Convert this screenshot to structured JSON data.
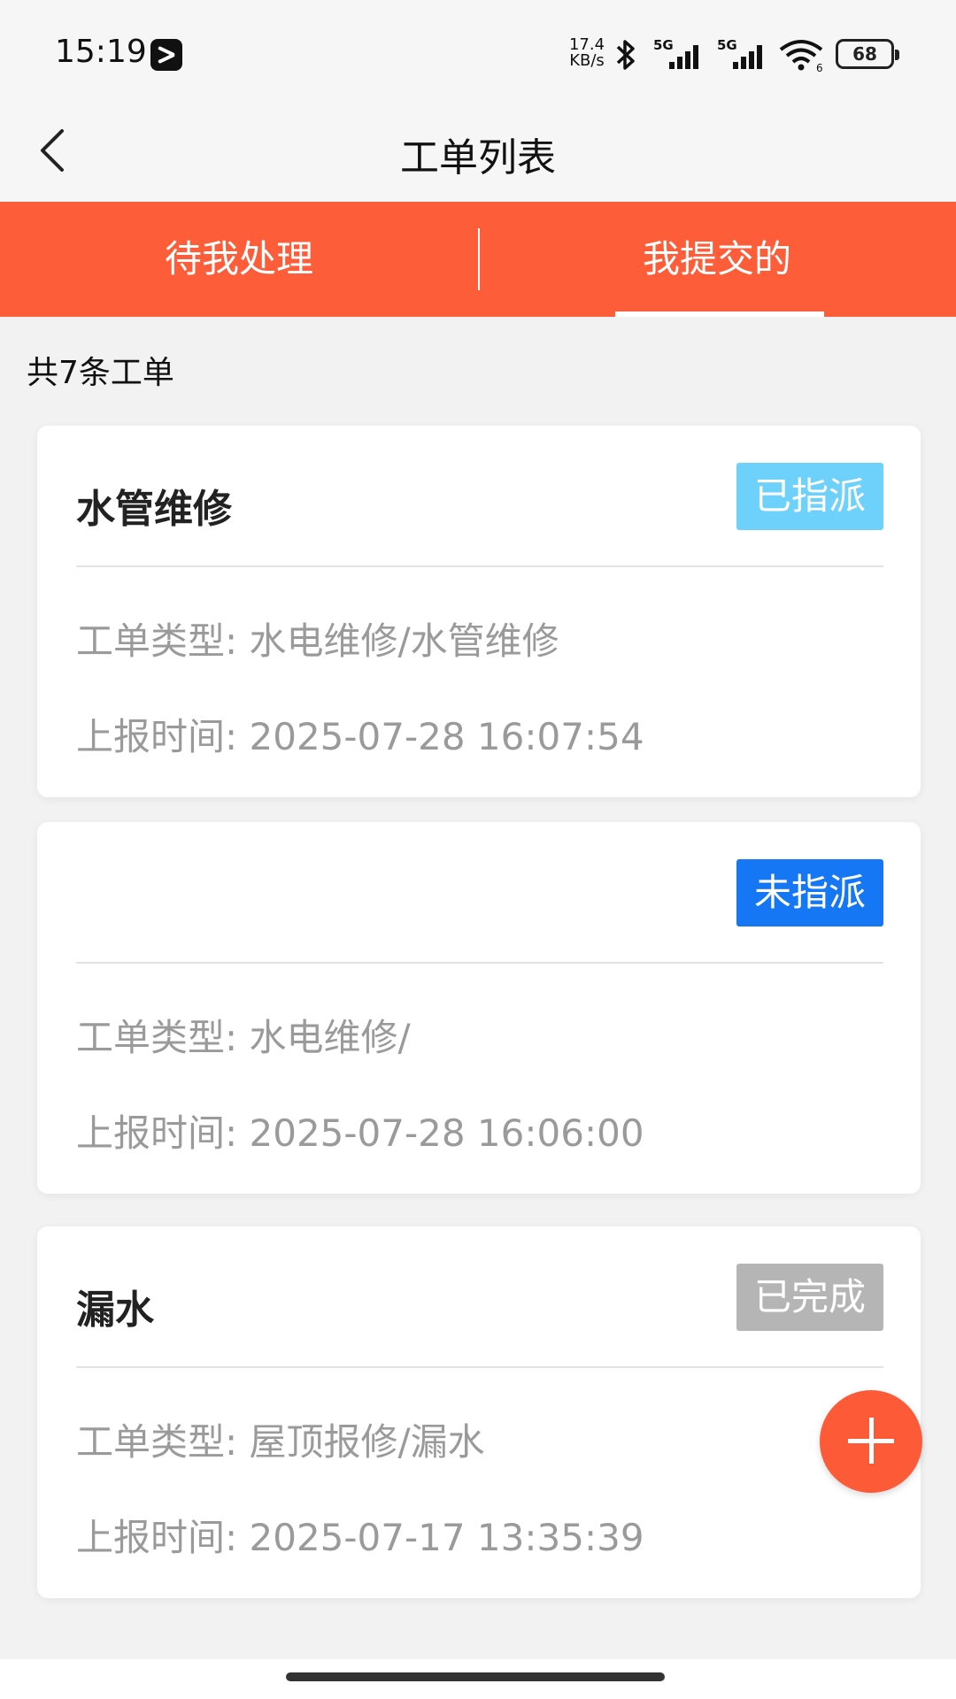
{
  "status_bar": {
    "time": "15:19",
    "net_speed_value": "17.4",
    "net_speed_unit": "KB/s",
    "signal_1_label": "5G",
    "signal_2_label": "5G",
    "wifi_level": "6",
    "battery": "68"
  },
  "header": {
    "title": "工单列表"
  },
  "tabs": [
    {
      "label": "待我处理",
      "active": false
    },
    {
      "label": "我提交的",
      "active": true
    }
  ],
  "count_text": "共7条工单",
  "cards": [
    {
      "title": "水管维修",
      "status": "已指派",
      "status_color": "#6dd1fb",
      "type_line": "工单类型: 水电维修/水管维修",
      "time_line": "上报时间: 2025-07-28 16:07:54"
    },
    {
      "title": "",
      "status": "未指派",
      "status_color": "#1677f5",
      "type_line": "工单类型: 水电维修/",
      "time_line": "上报时间: 2025-07-28 16:06:00"
    },
    {
      "title": "漏水",
      "status": "已完成",
      "status_color": "#b5b5b5",
      "type_line": "工单类型: 屋顶报修/漏水",
      "time_line": "上报时间: 2025-07-17 13:35:39"
    }
  ],
  "colors": {
    "accent": "#fd5d38",
    "fab": "#fd5a37",
    "background": "#f2f2f2"
  },
  "icons": [
    "capcut-icon",
    "bluetooth-icon",
    "signal-icon",
    "wifi-icon",
    "battery-icon",
    "back-arrow-icon",
    "plus-icon"
  ]
}
